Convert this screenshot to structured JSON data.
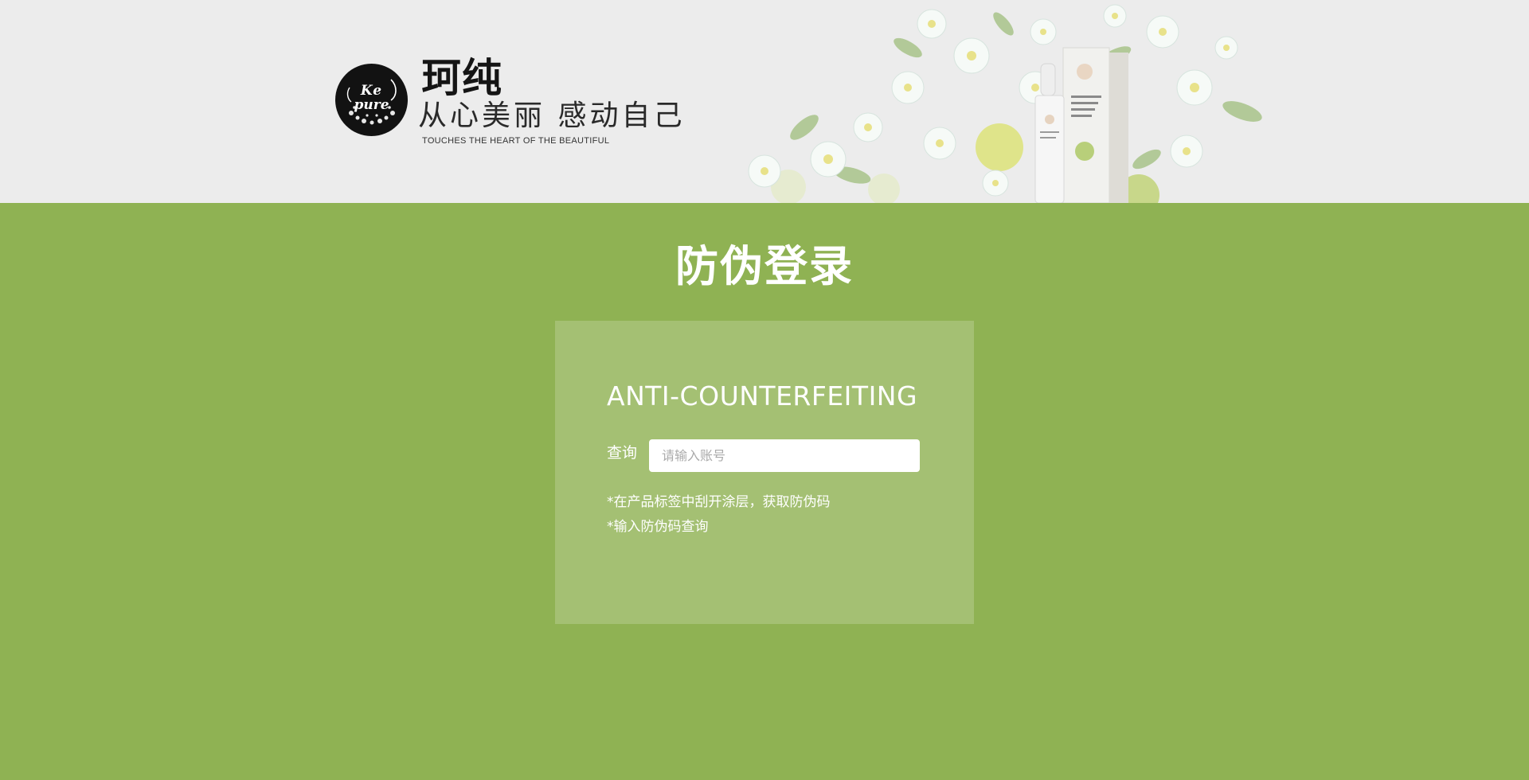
{
  "header": {
    "logo_mark_top": "Ke",
    "logo_mark_bottom": "pure",
    "brand_name": "珂纯",
    "slogan": "从心美丽  感动自己",
    "slogan_en": "TOUCHES THE HEART OF THE BEAUTIFUL"
  },
  "main": {
    "title": "防伪登录",
    "card": {
      "heading": "ANTI-COUNTERFEITING",
      "query_label": "查询",
      "query_placeholder": "请输入账号",
      "query_value": "",
      "hints": [
        "*在产品标签中刮开涂层，获取防伪码",
        "*输入防伪码查询"
      ]
    }
  },
  "colors": {
    "background_green": "#8fb253",
    "card_green": "#a4c073",
    "header_gray": "#ececec"
  }
}
